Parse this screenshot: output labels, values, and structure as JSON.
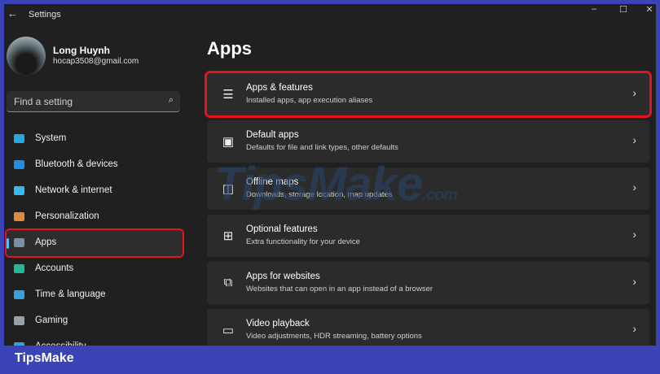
{
  "window": {
    "title": "Settings",
    "back": "←",
    "minimize": "–",
    "maximize": "☐",
    "close": "✕"
  },
  "user": {
    "name": "Long Huynh",
    "email": "hocap3508@gmail.com"
  },
  "search": {
    "placeholder": "Find a setting",
    "icon": "⌕"
  },
  "sidebar": {
    "items": [
      {
        "label": "System",
        "color": "#2aa7e0"
      },
      {
        "label": "Bluetooth & devices",
        "color": "#1e8fe6"
      },
      {
        "label": "Network & internet",
        "color": "#38b8f0"
      },
      {
        "label": "Personalization",
        "color": "#e08a3c"
      },
      {
        "label": "Apps",
        "color": "#7a8ea8"
      },
      {
        "label": "Accounts",
        "color": "#25b59a"
      },
      {
        "label": "Time & language",
        "color": "#3aa0e0"
      },
      {
        "label": "Gaming",
        "color": "#9aa0a8"
      },
      {
        "label": "Accessibility",
        "color": "#3aa0e0"
      }
    ]
  },
  "main": {
    "title": "Apps",
    "cards": [
      {
        "icon": "☰",
        "title": "Apps & features",
        "subtitle": "Installed apps, app execution aliases"
      },
      {
        "icon": "▣",
        "title": "Default apps",
        "subtitle": "Defaults for file and link types, other defaults"
      },
      {
        "icon": "◫",
        "title": "Offline maps",
        "subtitle": "Downloads, storage location, map updates"
      },
      {
        "icon": "⊞",
        "title": "Optional features",
        "subtitle": "Extra functionality for your device"
      },
      {
        "icon": "⧉",
        "title": "Apps for websites",
        "subtitle": "Websites that can open in an app instead of a browser"
      },
      {
        "icon": "▭",
        "title": "Video playback",
        "subtitle": "Video adjustments, HDR streaming, battery options"
      }
    ]
  },
  "watermark": {
    "text": "TipsMake",
    "suffix": ".com"
  },
  "footer": {
    "brand": "TipsMake"
  }
}
